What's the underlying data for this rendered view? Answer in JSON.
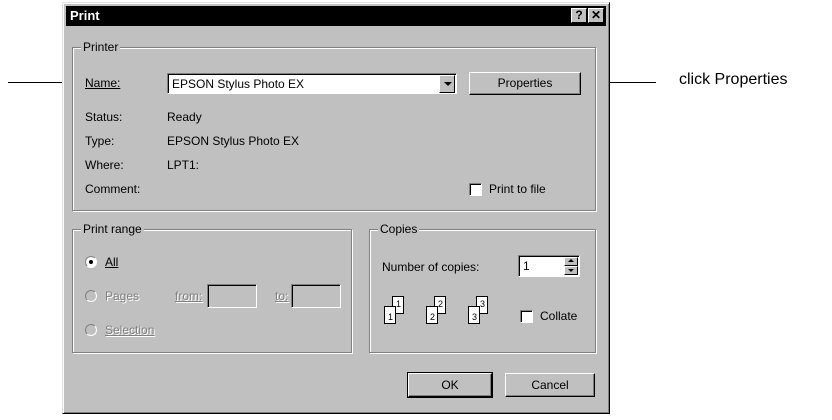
{
  "dialog": {
    "title": "Print",
    "help_button": "?",
    "close_button": "✕"
  },
  "printer": {
    "group_label": "Printer",
    "name_label": "Name:",
    "name_value": "EPSON Stylus Photo EX",
    "properties_button": "Properties",
    "status_label": "Status:",
    "status_value": "Ready",
    "type_label": "Type:",
    "type_value": "EPSON Stylus Photo EX",
    "where_label": "Where:",
    "where_value": "LPT1:",
    "comment_label": "Comment:",
    "print_to_file_label": "Print to file"
  },
  "print_range": {
    "group_label": "Print range",
    "all_label": "All",
    "pages_label": "Pages",
    "from_label": "from:",
    "to_label": "to:",
    "selection_label": "Selection"
  },
  "copies": {
    "group_label": "Copies",
    "number_label": "Number of copies:",
    "number_value": "1",
    "collate_label": "Collate",
    "page_icons": [
      "1",
      "1",
      "2",
      "2",
      "3",
      "3"
    ]
  },
  "actions": {
    "ok_button": "OK",
    "cancel_button": "Cancel"
  },
  "annotation": {
    "callout_text": "click Properties"
  }
}
